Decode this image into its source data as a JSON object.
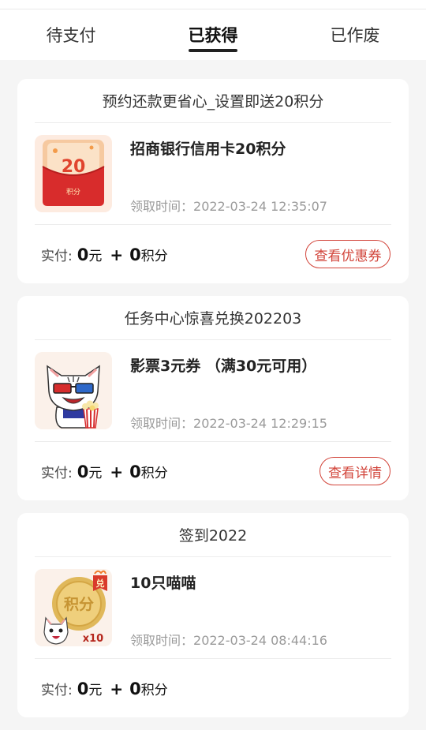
{
  "tabs": [
    {
      "label": "待支付",
      "active": false
    },
    {
      "label": "已获得",
      "active": true
    },
    {
      "label": "已作废",
      "active": false
    }
  ],
  "cards": [
    {
      "title": "预约还款更省心_设置即送20积分",
      "item_name": "招商银行信用卡20积分",
      "time_label": "领取时间：",
      "time_value": "2022-03-24 12:35:07",
      "pay_label": "实付:",
      "pay_cash": "0",
      "pay_cash_unit": "元",
      "pay_plus": "+",
      "pay_points": "0",
      "pay_points_unit": "积分",
      "button": "查看优惠券",
      "thumb": {
        "icon": "points-envelope-icon",
        "number": "20",
        "caption": "积分"
      }
    },
    {
      "title": "任务中心惊喜兑换202203",
      "item_name": "影票3元券 （满30元可用）",
      "time_label": "领取时间：",
      "time_value": "2022-03-24 12:29:15",
      "pay_label": "实付:",
      "pay_cash": "0",
      "pay_cash_unit": "元",
      "pay_plus": "+",
      "pay_points": "0",
      "pay_points_unit": "积分",
      "button": "查看详情",
      "thumb": {
        "icon": "cat-3d-glasses-popcorn-icon"
      }
    },
    {
      "title": "签到2022",
      "item_name": "10只喵喵",
      "time_label": "领取时间：",
      "time_value": "2022-03-24 08:44:16",
      "pay_label": "实付:",
      "pay_cash": "0",
      "pay_cash_unit": "元",
      "pay_plus": "+",
      "pay_points": "0",
      "pay_points_unit": "积分",
      "button": "",
      "thumb": {
        "icon": "points-coin-cat-icon",
        "coin_text": "积分",
        "badge": "兑",
        "multiplier": "x10"
      }
    }
  ],
  "colors": {
    "accent": "#d2443a",
    "background": "#f5f5f5",
    "card": "#ffffff"
  }
}
